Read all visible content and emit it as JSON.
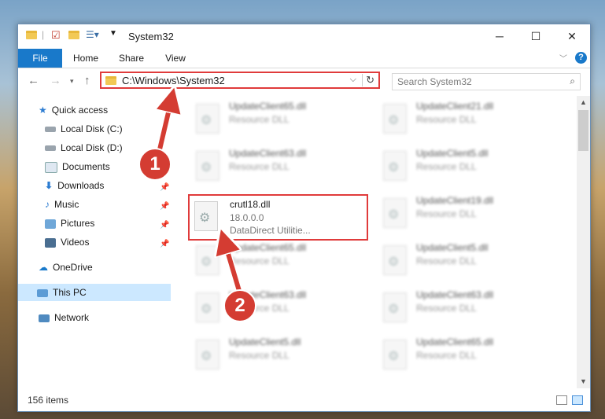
{
  "window": {
    "title": "System32"
  },
  "ribbon": {
    "tabs": [
      "File",
      "Home",
      "Share",
      "View"
    ]
  },
  "address": {
    "path": "C:\\Windows\\System32",
    "search_placeholder": "Search System32"
  },
  "nav": {
    "quick_access": "Quick access",
    "items": [
      "Local Disk (C:)",
      "Local Disk (D:)",
      "Documents",
      "Downloads",
      "Music",
      "Pictures",
      "Videos"
    ],
    "onedrive": "OneDrive",
    "this_pc": "This PC",
    "network": "Network"
  },
  "files": [
    {
      "name": "UpdateClient65.dll",
      "type": "Resource DLL"
    },
    {
      "name": "UpdateClient21.dll",
      "type": "Resource DLL"
    },
    {
      "name": "UpdateClient63.dll",
      "type": "Resource DLL"
    },
    {
      "name": "UpdateClient5.dll",
      "type": "Resource DLL"
    },
    {
      "name": "crutl18.dll",
      "version": "18.0.0.0",
      "description": "DataDirect Utilitie..."
    },
    {
      "name": "UpdateClient19.dll",
      "type": "Resource DLL"
    },
    {
      "name": "UpdateClient65.dll",
      "type": "Resource DLL"
    },
    {
      "name": "UpdateClient5.dll",
      "type": "Resource DLL"
    },
    {
      "name": "UpdateClient63.dll",
      "type": "Resource DLL"
    },
    {
      "name": "UpdateClient63.dll",
      "type": "Resource DLL"
    },
    {
      "name": "UpdateClient5.dll",
      "type": "Resource DLL"
    },
    {
      "name": "UpdateClient65.dll",
      "type": "Resource DLL"
    }
  ],
  "status": {
    "item_count": "156 items"
  },
  "callouts": [
    "1",
    "2"
  ],
  "colors": {
    "accent": "#1979ca",
    "highlight": "#e03b3b",
    "callout": "#d43c32"
  },
  "icons": {
    "help": "?",
    "refresh": "↻",
    "search": "⌕",
    "pin": "📌"
  }
}
